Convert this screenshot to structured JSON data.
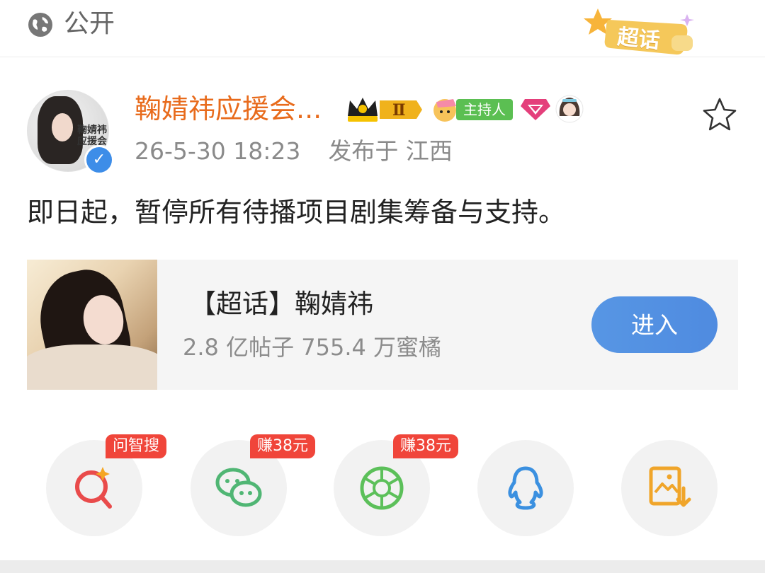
{
  "header": {
    "privacy": "公开",
    "privacy_icon": "globe-icon",
    "topic_badge": "超话"
  },
  "post": {
    "username": "鞠婧祎应援会...",
    "avatar_text": [
      "鞠婧祎",
      "应援会"
    ],
    "crown_level": "Ⅱ",
    "host_badge": "主持人",
    "timestamp": "26-5-30 18:23",
    "location": "发布于 江西",
    "text": "即日起，暂停所有待播项目剧集筹备与支持。"
  },
  "topic_card": {
    "title": "【超话】鞠婧祎",
    "stats": "2.8 亿帖子 755.4 万蜜橘",
    "enter_label": "进入"
  },
  "share": [
    {
      "name": "ai-search",
      "icon": "ai-search-icon",
      "tag": "问智搜",
      "color": "#e94b4b"
    },
    {
      "name": "wechat",
      "icon": "wechat-icon",
      "tag": "赚38元",
      "color": "#50b674"
    },
    {
      "name": "moments",
      "icon": "moments-icon",
      "tag": "赚38元",
      "color": "#5cc05a"
    },
    {
      "name": "qq",
      "icon": "qq-icon",
      "tag": "",
      "color": "#3b90e0"
    },
    {
      "name": "save-image",
      "icon": "save-image-icon",
      "tag": "",
      "color": "#f0a52a"
    }
  ],
  "colors": {
    "username": "#e86b1c",
    "enter_button": "#5796e4",
    "promo_tag": "#f0453a"
  }
}
